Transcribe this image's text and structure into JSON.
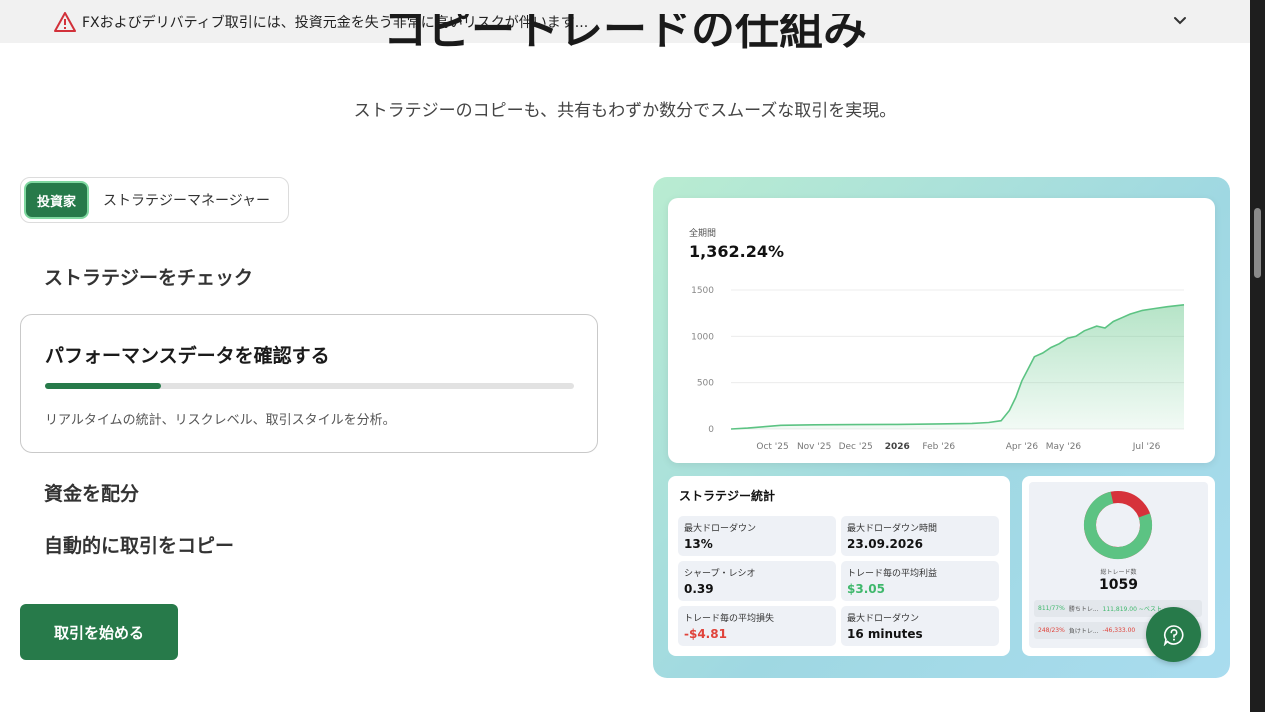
{
  "banner": {
    "text": "FXおよびデリバティブ取引には、投資元金を失う非常に高いリスクが伴います..."
  },
  "hero": {
    "title": "コピートレードの仕組み",
    "subtitle": "ストラテジーのコピーも、共有もわずか数分でスムーズな取引を実現。"
  },
  "tabs": [
    {
      "label": "投資家",
      "active": true
    },
    {
      "label": "ストラテジーマネージャー",
      "active": false
    }
  ],
  "steps": {
    "step1": "ストラテジーをチェック",
    "step2_title": "パフォーマンスデータを確認する",
    "step2_desc": "リアルタイムの統計、リスクレベル、取引スタイルを分析。",
    "step2_progress": 0.22,
    "step3": "資金を配分",
    "step4": "自動的に取引をコピー"
  },
  "cta": {
    "label": "取引を始める"
  },
  "preview": {
    "period_label": "全期間",
    "period_value": "1,362.24%",
    "stats_title": "ストラテジー統計",
    "stats": [
      {
        "key": "最大ドローダウン",
        "value": "13%",
        "tone": ""
      },
      {
        "key": "最大ドローダウン時間",
        "value": "23.09.2026",
        "tone": ""
      },
      {
        "key": "シャープ・レシオ",
        "value": "0.39",
        "tone": ""
      },
      {
        "key": "トレード毎の平均利益",
        "value": "$3.05",
        "tone": "pos"
      },
      {
        "key": "トレード毎の平均損失",
        "value": "-$4.81",
        "tone": "neg"
      },
      {
        "key": "最大ドローダウン",
        "value": "16 minutes",
        "tone": ""
      }
    ],
    "donut": {
      "caption": "総トレード数",
      "total": "1059",
      "win_fraction": 0.77,
      "win_color": "#5cc383",
      "loss_color": "#d6323b",
      "win_row": {
        "count": "811/77%",
        "label": "勝ちトレ...",
        "amount": "111,819.00 ~ベスト..."
      },
      "loss_row": {
        "count": "248/23%",
        "label": "負けトレ...",
        "amount": "-46,333.00"
      }
    }
  },
  "chart_data": {
    "type": "area",
    "title": "",
    "xlabel": "",
    "ylabel": "",
    "ylim": [
      0,
      1500
    ],
    "yticks": [
      0,
      500,
      1000,
      1500
    ],
    "grid": true,
    "color": "#5cc383",
    "x_tick_labels": [
      "Oct '25",
      "Nov '25",
      "Dec '25",
      "2026",
      "Feb '26",
      "Apr '26",
      "May '26",
      "Jul '26"
    ],
    "x_tick_positions": [
      1.0,
      2.0,
      3.0,
      4.0,
      5.0,
      7.0,
      8.0,
      10.0
    ],
    "x": [
      0.0,
      0.4,
      0.8,
      1.2,
      1.6,
      2.0,
      3.0,
      4.0,
      5.0,
      5.8,
      6.2,
      6.5,
      6.7,
      6.85,
      7.0,
      7.15,
      7.3,
      7.5,
      7.7,
      7.9,
      8.1,
      8.3,
      8.5,
      8.8,
      9.0,
      9.2,
      9.4,
      9.6,
      9.9,
      10.2,
      10.5,
      10.9
    ],
    "series": [
      {
        "values": [
          0,
          10,
          25,
          40,
          42,
          45,
          48,
          50,
          55,
          60,
          70,
          90,
          200,
          340,
          520,
          650,
          780,
          820,
          880,
          920,
          980,
          1000,
          1060,
          1110,
          1090,
          1160,
          1200,
          1240,
          1280,
          1300,
          1320,
          1340
        ]
      }
    ]
  }
}
